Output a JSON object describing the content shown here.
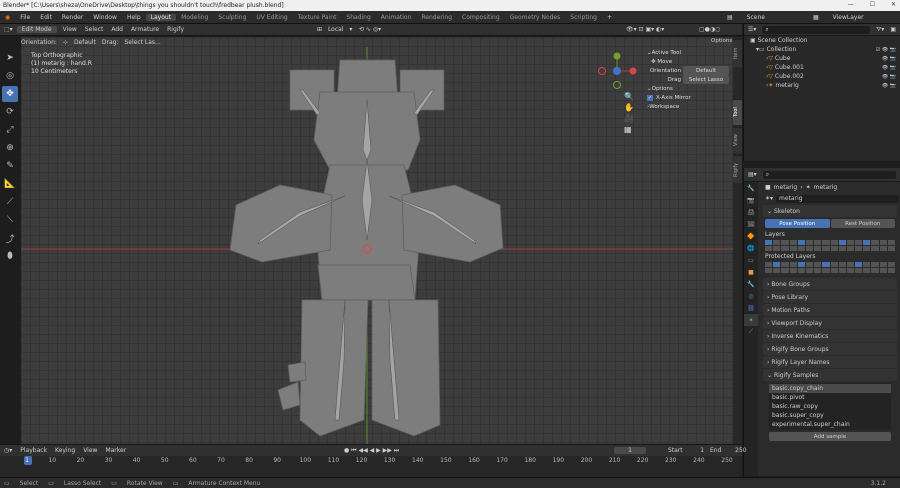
{
  "window": {
    "title": "Blender* [C:\\Users\\sheza\\OneDrive\\Desktop\\things you shouldn't touch\\fredbear plush.blend]",
    "min": "—",
    "max": "☐",
    "close": "✕"
  },
  "menu": [
    "File",
    "Edit",
    "Render",
    "Window",
    "Help"
  ],
  "workspaces": [
    "Layout",
    "Modeling",
    "Sculpting",
    "UV Editing",
    "Texture Paint",
    "Shading",
    "Animation",
    "Rendering",
    "Compositing",
    "Geometry Nodes",
    "Scripting"
  ],
  "scene": "Scene",
  "view_layer": "ViewLayer",
  "header": {
    "mode": "Edit Mode",
    "menus": [
      "View",
      "Select",
      "Add",
      "Armature",
      "Rigify"
    ],
    "transform": "Local"
  },
  "subheader": {
    "orientation_label": "Orientation:",
    "orientation": "Default",
    "drag_label": "Drag:",
    "drag": "Select Las..."
  },
  "viewport": {
    "view": "Top Orthographic",
    "object": "(1) metarig : hand.R",
    "scale": "10 Centimeters"
  },
  "npanel": {
    "active_tool": "Active Tool",
    "move": "Move",
    "orientation_label": "Orientation",
    "orientation": "Default",
    "drag_label": "Drag",
    "drag": "Select Lasso",
    "options": "Options",
    "xmirror": "X-Axis Mirror",
    "workspace": "Workspace",
    "options_btn": "Options"
  },
  "side_tabs": [
    "Item",
    "Tool",
    "View",
    "Rigify"
  ],
  "outliner": {
    "root": "Scene Collection",
    "items": [
      {
        "name": "Collection",
        "indent": 0
      },
      {
        "name": "Cube",
        "indent": 1
      },
      {
        "name": "Cube.001",
        "indent": 1
      },
      {
        "name": "Cube.002",
        "indent": 1
      },
      {
        "name": "metarig",
        "indent": 1
      }
    ]
  },
  "props": {
    "breadcrumb_a": "metarig",
    "breadcrumb_b": "metarig",
    "name_field": "metarig",
    "skeleton": "Skeleton",
    "pose_position": "Pose Position",
    "rest_position": "Rest Position",
    "layers": "Layers",
    "protected_layers": "Protected Layers",
    "layers_on": [
      0,
      4,
      9,
      12
    ],
    "protected_on": [
      1,
      4,
      7,
      11
    ],
    "sections": [
      "Bone Groups",
      "Pose Library",
      "Motion Paths",
      "Viewport Display",
      "Inverse Kinematics",
      "Rigify Bone Groups",
      "Rigify Layer Names",
      "Rigify Samples"
    ],
    "samples": [
      "basic.copy_chain",
      "basic.pivot",
      "basic.raw_copy",
      "basic.super_copy",
      "experimental.super_chain"
    ],
    "add_sample": "Add sample"
  },
  "timeline": {
    "menus": [
      "Playback",
      "Keying",
      "View",
      "Marker"
    ],
    "current": "1",
    "start_label": "Start",
    "start": "1",
    "end_label": "End",
    "end": "250",
    "ticks": [
      "1",
      "10",
      "20",
      "30",
      "40",
      "50",
      "60",
      "70",
      "80",
      "90",
      "100",
      "110",
      "120",
      "130",
      "140",
      "150",
      "160",
      "170",
      "180",
      "190",
      "200",
      "210",
      "220",
      "230",
      "240",
      "250"
    ]
  },
  "status": {
    "select": "Select",
    "lasso": "Lasso Select",
    "rotate": "Rotate View",
    "context": "Armature Context Menu",
    "version": "3.1.2"
  }
}
